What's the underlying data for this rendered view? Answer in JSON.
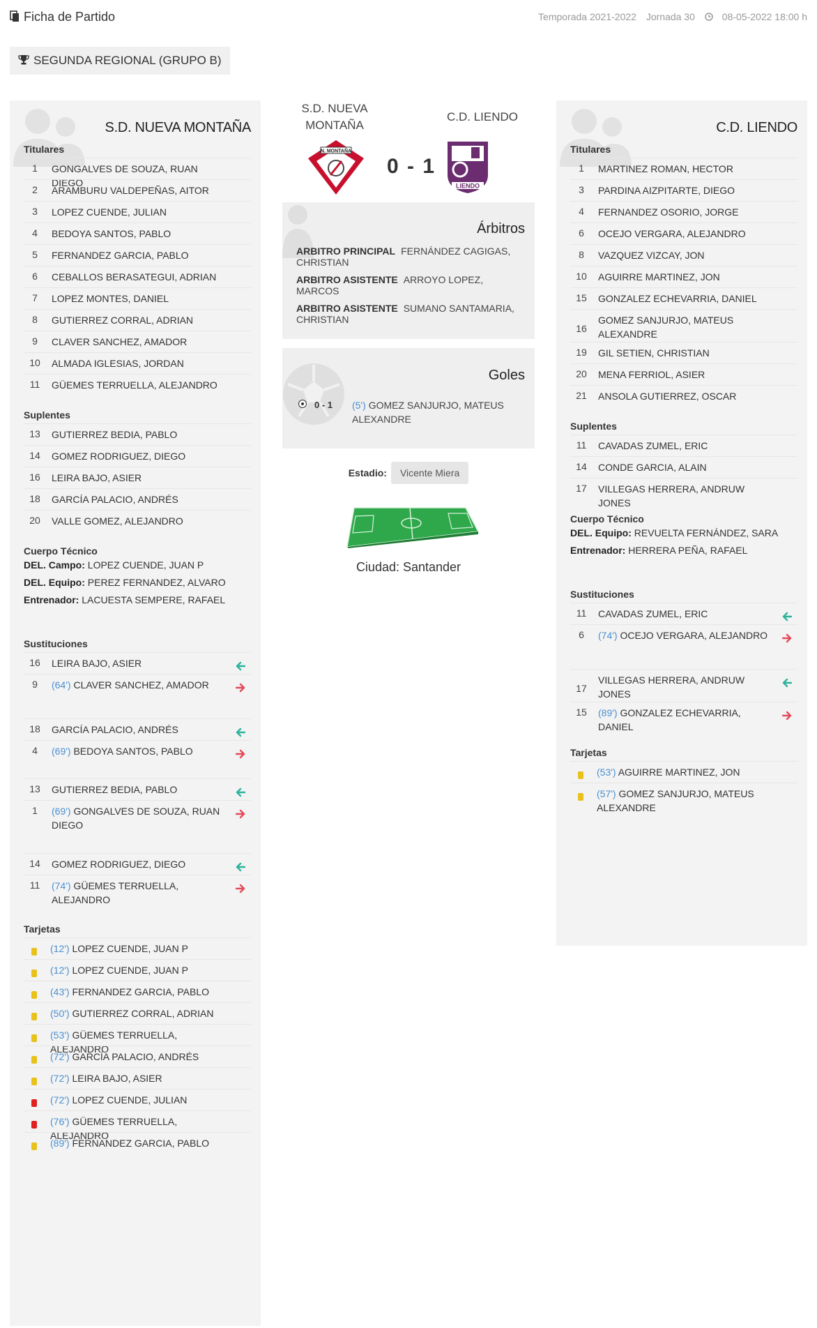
{
  "header": {
    "title": "Ficha de Partido",
    "season": "Temporada 2021-2022",
    "round": "Jornada 30",
    "datetime": "08-05-2022 18:00 h"
  },
  "league": "SEGUNDA REGIONAL (GRUPO B)",
  "match": {
    "home": "S.D. NUEVA MONTAÑA",
    "home_center_line1": "S.D. NUEVA",
    "home_center_line2": "MONTAÑA",
    "away": "C.D. LIENDO",
    "score": "0 - 1"
  },
  "referees": {
    "title": "Árbitros",
    "items": [
      {
        "role": "ARBITRO PRINCIPAL",
        "name": "FERNÁNDEZ CAGIGAS, CHRISTIAN"
      },
      {
        "role": "ARBITRO ASISTENTE",
        "name": "ARROYO LOPEZ, MARCOS"
      },
      {
        "role": "ARBITRO ASISTENTE",
        "name": "SUMANO SANTAMARIA, CHRISTIAN"
      }
    ]
  },
  "goals": {
    "title": "Goles",
    "items": [
      {
        "score": "0 - 1",
        "minute": "(5')",
        "player": "GOMEZ SANJURJO, MATEUS ALEXANDRE"
      }
    ]
  },
  "venue": {
    "stadium_label": "Estadio:",
    "stadium": "Vicente Miera",
    "city": "Ciudad: Santander"
  },
  "labels": {
    "starters": "Titulares",
    "subs": "Suplentes",
    "staff": "Cuerpo Técnico",
    "substitutions": "Sustituciones",
    "cards": "Tarjetas"
  },
  "home": {
    "name": "S.D. NUEVA MONTAÑA",
    "starters": [
      {
        "num": "1",
        "name": "GONGALVES DE SOUZA, RUAN DIEGO"
      },
      {
        "num": "2",
        "name": "ARAMBURU VALDEPEÑAS, AITOR"
      },
      {
        "num": "3",
        "name": "LOPEZ CUENDE, JULIAN"
      },
      {
        "num": "4",
        "name": "BEDOYA SANTOS, PABLO"
      },
      {
        "num": "5",
        "name": "FERNANDEZ GARCIA, PABLO"
      },
      {
        "num": "6",
        "name": "CEBALLOS BERASATEGUI, ADRIAN"
      },
      {
        "num": "7",
        "name": "LOPEZ MONTES, DANIEL"
      },
      {
        "num": "8",
        "name": "GUTIERREZ CORRAL, ADRIAN"
      },
      {
        "num": "9",
        "name": "CLAVER SANCHEZ, AMADOR"
      },
      {
        "num": "10",
        "name": "ALMADA IGLESIAS, JORDAN"
      },
      {
        "num": "11",
        "name": "GÜEMES TERRUELLA, ALEJANDRO"
      }
    ],
    "subs": [
      {
        "num": "13",
        "name": "GUTIERREZ BEDIA, PABLO"
      },
      {
        "num": "14",
        "name": "GOMEZ RODRIGUEZ, DIEGO"
      },
      {
        "num": "16",
        "name": "LEIRA BAJO, ASIER"
      },
      {
        "num": "18",
        "name": "GARCÍA PALACIO, ANDRÉS"
      },
      {
        "num": "20",
        "name": "VALLE GOMEZ, ALEJANDRO"
      }
    ],
    "staff": [
      {
        "role": "DEL. Campo:",
        "name": "LOPEZ CUENDE, JUAN P"
      },
      {
        "role": "DEL. Equipo:",
        "name": "PEREZ FERNANDEZ, ALVARO"
      },
      {
        "role": "Entrenador:",
        "name": "LACUESTA SEMPERE, RAFAEL"
      }
    ],
    "substitutions": [
      {
        "in_num": "16",
        "in_name": "LEIRA BAJO, ASIER",
        "out_num": "9",
        "minute": "(64')",
        "out_name": "CLAVER SANCHEZ, AMADOR"
      },
      {
        "in_num": "18",
        "in_name": "GARCÍA PALACIO, ANDRÉS",
        "out_num": "4",
        "minute": "(69')",
        "out_name": "BEDOYA SANTOS, PABLO"
      },
      {
        "in_num": "13",
        "in_name": "GUTIERREZ BEDIA, PABLO",
        "out_num": "1",
        "minute": "(69')",
        "out_name": "GONGALVES DE SOUZA, RUAN DIEGO"
      },
      {
        "in_num": "14",
        "in_name": "GOMEZ RODRIGUEZ, DIEGO",
        "out_num": "11",
        "minute": "(74')",
        "out_name": "GÜEMES TERRUELLA, ALEJANDRO"
      }
    ],
    "cards": [
      {
        "type": "yellow",
        "minute": "(12')",
        "name": "LOPEZ CUENDE, JUAN P"
      },
      {
        "type": "yellow",
        "minute": "(12')",
        "name": "LOPEZ CUENDE, JUAN P"
      },
      {
        "type": "yellow",
        "minute": "(43')",
        "name": "FERNANDEZ GARCIA, PABLO"
      },
      {
        "type": "yellow",
        "minute": "(50')",
        "name": "GUTIERREZ CORRAL, ADRIAN"
      },
      {
        "type": "yellow",
        "minute": "(53')",
        "name": "GÜEMES TERRUELLA, ALEJANDRO"
      },
      {
        "type": "yellow",
        "minute": "(72')",
        "name": "GARCÍA PALACIO, ANDRÉS"
      },
      {
        "type": "yellow",
        "minute": "(72')",
        "name": "LEIRA BAJO, ASIER"
      },
      {
        "type": "red",
        "minute": "(72')",
        "name": "LOPEZ CUENDE, JULIAN"
      },
      {
        "type": "red",
        "minute": "(76')",
        "name": "GÜEMES TERRUELLA, ALEJANDRO"
      },
      {
        "type": "yellow",
        "minute": "(89')",
        "name": "FERNANDEZ GARCIA, PABLO"
      }
    ]
  },
  "away": {
    "name": "C.D. LIENDO",
    "starters": [
      {
        "num": "1",
        "name": "MARTINEZ ROMAN, HECTOR"
      },
      {
        "num": "3",
        "name": "PARDINA AIZPITARTE, DIEGO"
      },
      {
        "num": "4",
        "name": "FERNANDEZ OSORIO, JORGE"
      },
      {
        "num": "6",
        "name": "OCEJO VERGARA, ALEJANDRO"
      },
      {
        "num": "8",
        "name": "VAZQUEZ VIZCAY, JON"
      },
      {
        "num": "10",
        "name": "AGUIRRE MARTINEZ, JON"
      },
      {
        "num": "15",
        "name": "GONZALEZ ECHEVARRIA, DANIEL"
      },
      {
        "num": "16",
        "name": "GOMEZ SANJURJO, MATEUS ALEXANDRE"
      },
      {
        "num": "19",
        "name": "GIL SETIEN, CHRISTIAN"
      },
      {
        "num": "20",
        "name": "MENA FERRIOL, ASIER"
      },
      {
        "num": "21",
        "name": "ANSOLA GUTIERREZ, OSCAR"
      }
    ],
    "subs": [
      {
        "num": "11",
        "name": "CAVADAS ZUMEL, ERIC"
      },
      {
        "num": "14",
        "name": "CONDE GARCIA, ALAIN"
      },
      {
        "num": "17",
        "name": "VILLEGAS HERRERA, ANDRUW JONES"
      }
    ],
    "staff": [
      {
        "role": "DEL. Equipo:",
        "name": "REVUELTA FERNÁNDEZ, SARA"
      },
      {
        "role": "Entrenador:",
        "name": "HERRERA PEÑA, RAFAEL"
      }
    ],
    "substitutions": [
      {
        "in_num": "11",
        "in_name": "CAVADAS ZUMEL, ERIC",
        "out_num": "6",
        "minute": "(74')",
        "out_name": "OCEJO VERGARA, ALEJANDRO"
      },
      {
        "in_num": "17",
        "in_name": "VILLEGAS HERRERA, ANDRUW JONES",
        "out_num": "15",
        "minute": "(89')",
        "out_name": "GONZALEZ ECHEVARRIA, DANIEL"
      }
    ],
    "cards": [
      {
        "type": "yellow",
        "minute": "(53')",
        "name": "AGUIRRE MARTINEZ, JON"
      },
      {
        "type": "yellow",
        "minute": "(57')",
        "name": "GOMEZ SANJURJO, MATEUS ALEXANDRE"
      }
    ]
  },
  "colors": {
    "minute": "#4a8fd0",
    "arrow_in": "#2bb39a",
    "arrow_out": "#e24b5a",
    "yellow_card": "#e8c21b",
    "red_card": "#e0201f",
    "panel_bg": "#f3f3f3"
  }
}
